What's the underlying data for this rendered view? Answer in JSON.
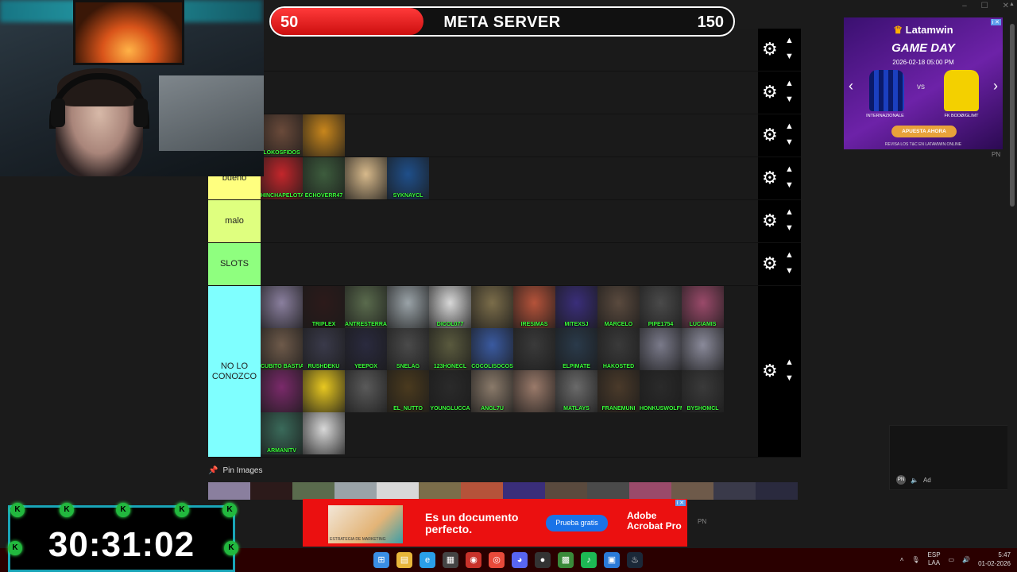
{
  "window_controls": [
    "–",
    "☐",
    "✕"
  ],
  "scorebar": {
    "left_value": "50",
    "title": "META SERVER",
    "right_value": "150",
    "progress_fraction": 0.33
  },
  "tiers": [
    {
      "label": "",
      "color": "#1a1a1a",
      "rows": 1,
      "items": []
    },
    {
      "label": "",
      "color": "#1a1a1a",
      "rows": 1,
      "items": []
    },
    {
      "label": "",
      "color": "#1a1a1a",
      "rows": 1,
      "items": [
        {
          "name": "LOKOSFIDOS",
          "color": "#6a4a3a"
        },
        {
          "name": "",
          "color": "#c8861c"
        }
      ]
    },
    {
      "label": "bueno",
      "color": "#ffff7f",
      "rows": 1,
      "items": [
        {
          "name": "HINCHAPELOTA",
          "color": "#c3262b"
        },
        {
          "name": "ECHOVERR47",
          "color": "#3d5c3d"
        },
        {
          "name": "",
          "color": "#d7b98b"
        },
        {
          "name": "SYKNAYCL",
          "color": "#1f4f8a"
        }
      ]
    },
    {
      "label": "malo",
      "color": "#dfff7f",
      "rows": 1,
      "items": []
    },
    {
      "label": "SLOTS",
      "color": "#8fff7f",
      "rows": 1,
      "items": []
    },
    {
      "label": "NO LO\nCONOZCO",
      "color": "#7fffff",
      "rows": 4,
      "items": [
        {
          "name": "",
          "color": "#8a7f9e"
        },
        {
          "name": "TRIPLEX",
          "color": "#2c1a1a"
        },
        {
          "name": "ANTRESTERRA",
          "color": "#5a6b4d"
        },
        {
          "name": "",
          "color": "#9aa3a8"
        },
        {
          "name": "DICOL077",
          "color": "#d8d8d8"
        },
        {
          "name": "",
          "color": "#7b6d4a"
        },
        {
          "name": "IRESIMAS",
          "color": "#b5533a"
        },
        {
          "name": "MITEXSJ",
          "color": "#3a2e7a"
        },
        {
          "name": "MARCELO",
          "color": "#5a4a3e"
        },
        {
          "name": "PIPE1754",
          "color": "#4a4a4a"
        },
        {
          "name": "LUCIAMIS",
          "color": "#9a4a6a"
        },
        {
          "name": "CUBITO BASTIAN",
          "color": "#6e5a4a"
        },
        {
          "name": "RUSHDEKU",
          "color": "#3a3a4a"
        },
        {
          "name": "YEEPOX",
          "color": "#2a2a3e"
        },
        {
          "name": "SNELAG",
          "color": "#4a4a4a"
        },
        {
          "name": "123HONECL",
          "color": "#5a5a3e"
        },
        {
          "name": "COCOLISOCOS",
          "color": "#3a5aa0"
        },
        {
          "name": "",
          "color": "#3a3a3a"
        },
        {
          "name": "ELPIMATE",
          "color": "#2a3a4a"
        },
        {
          "name": "HAKOSTED",
          "color": "#3a3a3a"
        },
        {
          "name": "",
          "color": "#7a7a8a"
        },
        {
          "name": "",
          "color": "#8a8a9a"
        },
        {
          "name": "",
          "color": "#7a2a6a"
        },
        {
          "name": "",
          "color": "#e8c820"
        },
        {
          "name": "",
          "color": "#5a5a5a"
        },
        {
          "name": "EL_NUTTO",
          "color": "#4a3a1e"
        },
        {
          "name": "YOUNGLUCCA",
          "color": "#2a2a2a"
        },
        {
          "name": "ANGL7U",
          "color": "#8a7a6a"
        },
        {
          "name": "",
          "color": "#9a7a6a"
        },
        {
          "name": "MATLAYS",
          "color": "#6a6a6a"
        },
        {
          "name": "FRANEMUNI",
          "color": "#4a3a2a"
        },
        {
          "name": "HONKUSWOLFM",
          "color": "#2a2a2a"
        },
        {
          "name": "BYSHOMCL",
          "color": "#3a3a3a"
        },
        {
          "name": "ARMANITV",
          "color": "#3a6a5a"
        },
        {
          "name": "",
          "color": "#d8d8d8"
        }
      ]
    }
  ],
  "controls": {
    "gear_icon": "⚙",
    "up_icon": "▲",
    "down_icon": "▼"
  },
  "pin_images": {
    "label": "Pin Images"
  },
  "ad_right": {
    "brand": "Latamwin",
    "headline": "GAME DAY",
    "datetime": "2026-02-18 05:00 PM",
    "team1": "INTERNAZIONALE",
    "vs": "vs",
    "team2": "FK BODØ/GLIMT",
    "cta": "APUESTA AHORA",
    "terms": "REVISA LOS T&C EN LATAMWIN.ONLINE",
    "pn": "PN"
  },
  "ad_small": {
    "label": "Ad",
    "pn": "PN"
  },
  "timer": {
    "value": "30:31:02"
  },
  "ad_bottom": {
    "text": "Es un documento perfecto.",
    "button": "Prueba gratis",
    "logo": "Adobe Acrobat Pro",
    "image_caption": "ESTRATEGIA DE MARKETING",
    "pn": "PN"
  },
  "taskbar": {
    "apps": [
      "start",
      "files",
      "edge",
      "store",
      "voice",
      "chrome",
      "discord",
      "obs",
      "minecraft",
      "spotify",
      "photos",
      "steam"
    ],
    "lang_top": "ESP",
    "lang_bottom": "LAA",
    "time": "5:47",
    "date": "01-02-2026"
  }
}
